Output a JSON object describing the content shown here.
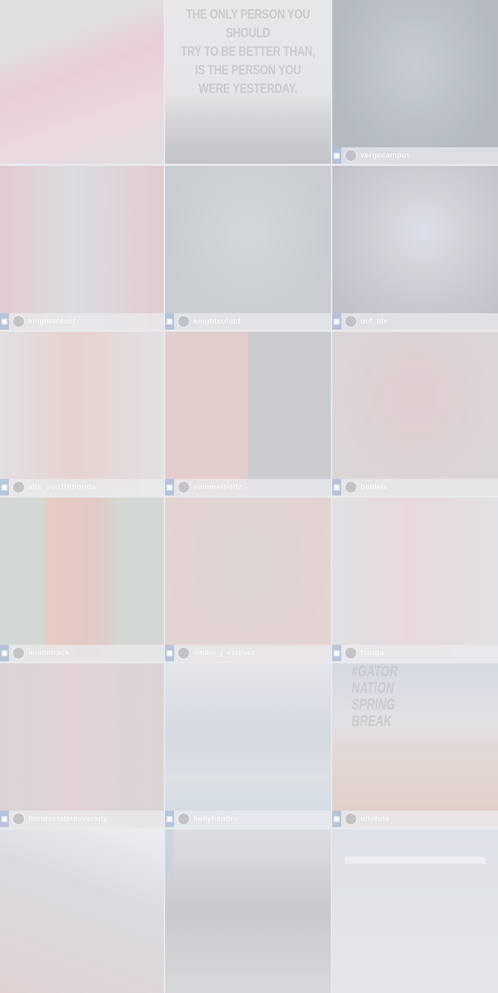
{
  "tiles": [
    {
      "username": "",
      "show_bar": false,
      "scene": "A",
      "colors": [
        "#e9a7b3",
        "#d7d1c8"
      ]
    },
    {
      "username": "",
      "show_bar": false,
      "scene": "Q",
      "quote": [
        "THE ONLY PERSON YOU SHOULD",
        "TRY TO BE BETTER THAN,",
        "IS THE PERSON YOU",
        "WERE YESTERDAY."
      ],
      "colors": [
        "#cfcfd2",
        "#bdbdc0"
      ]
    },
    {
      "username": "vergecampus",
      "show_bar": true,
      "scene": "C",
      "colors": [
        "#9aa6b0",
        "#6f7b86"
      ]
    },
    {
      "username": "knightsofucf",
      "show_bar": true,
      "scene": "B",
      "colors": [
        "#d7a3a6",
        "#c9c9cf"
      ]
    },
    {
      "username": "knightsofucf",
      "show_bar": true,
      "scene": "C",
      "colors": [
        "#b7bfc2",
        "#9da7aa"
      ]
    },
    {
      "username": "ucf_life",
      "show_bar": true,
      "scene": "D",
      "colors": [
        "#b9b7c0",
        "#8d8a96"
      ]
    },
    {
      "username": "ahs_sou1thflorida",
      "show_bar": true,
      "scene": "B",
      "colors": [
        "#d9d4d1",
        "#e3b3a6"
      ]
    },
    {
      "username": "summerholtz",
      "show_bar": true,
      "scene": "E",
      "colors": [
        "#dba6a0",
        "#c9d2c6"
      ]
    },
    {
      "username": "benleis",
      "show_bar": true,
      "scene": "C",
      "colors": [
        "#d6a9a8",
        "#c9b9b3"
      ]
    },
    {
      "username": "miamitrack",
      "show_bar": true,
      "scene": "F",
      "colors": [
        "#b5c2b1",
        "#e3a486"
      ]
    },
    {
      "username": "emilio_j_estevez",
      "show_bar": true,
      "scene": "C",
      "colors": [
        "#cbb9b1",
        "#dbb6ab"
      ]
    },
    {
      "username": "fsutga",
      "show_bar": true,
      "scene": "B",
      "colors": [
        "#d7d5d6",
        "#e6c2c6"
      ]
    },
    {
      "username": "floridastateuniversity",
      "show_bar": true,
      "scene": "B",
      "colors": [
        "#c9b7b0",
        "#d7b4b3"
      ]
    },
    {
      "username": "hollyhandro",
      "show_bar": true,
      "scene": "G",
      "colors": [
        "#b9c3cf",
        "#cdd4da"
      ]
    },
    {
      "username": "uflorida",
      "show_bar": true,
      "scene": "H",
      "hashtag": [
        "#GATOR",
        "NATION",
        "SPRING",
        "BREAK"
      ],
      "colors": [
        "#d9c4ba",
        "#b8c4cf"
      ]
    },
    {
      "username": "",
      "show_bar": false,
      "scene": "I",
      "colors": [
        "#c6c8cd",
        "#d5b3ad"
      ]
    },
    {
      "username": "",
      "show_bar": false,
      "scene": "J",
      "colors": [
        "#cfcfd2",
        "#c0c1c4"
      ]
    },
    {
      "username": "",
      "show_bar": false,
      "scene": "K",
      "colors": [
        "#cfd6dd",
        "#dfe3e6"
      ]
    }
  ]
}
